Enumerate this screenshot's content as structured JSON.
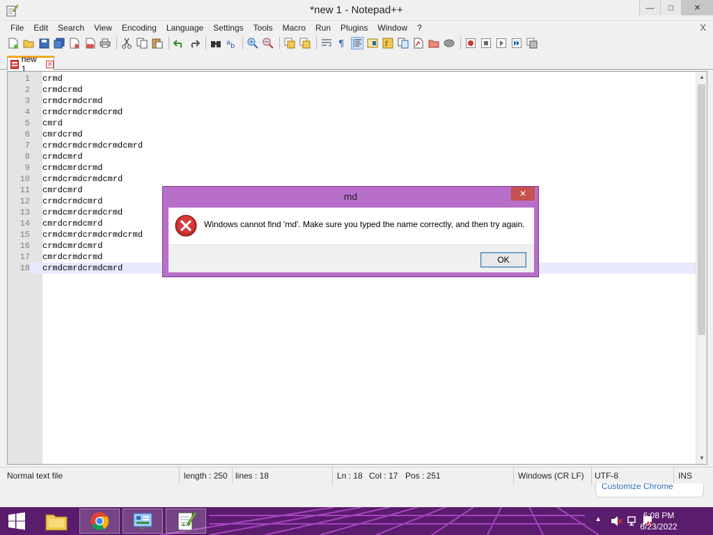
{
  "window": {
    "title": "*new 1 - Notepad++",
    "minimize_glyph": "—",
    "maximize_glyph": "□",
    "close_glyph": "✕"
  },
  "menu": {
    "items": [
      "File",
      "Edit",
      "Search",
      "View",
      "Encoding",
      "Language",
      "Settings",
      "Tools",
      "Macro",
      "Run",
      "Plugins",
      "Window",
      "?"
    ],
    "close_glyph": "X"
  },
  "toolbar": {
    "icons": [
      "new-file-icon",
      "open-file-icon",
      "save-icon",
      "save-all-icon",
      "close-icon",
      "close-all-icon",
      "print-icon",
      "sep",
      "cut-icon",
      "copy-icon",
      "paste-icon",
      "sep",
      "undo-icon",
      "redo-icon",
      "sep",
      "find-icon",
      "replace-icon",
      "sep",
      "zoom-in-icon",
      "zoom-out-icon",
      "sep",
      "sync-vertical-icon",
      "sync-horizontal-icon",
      "sep",
      "word-wrap-icon",
      "show-all-chars-icon",
      "indent-guide-icon",
      "document-map-icon",
      "function-list-icon",
      "folder-as-workspace-icon",
      "monitoring-icon",
      "sep",
      "record-macro-icon",
      "stop-macro-icon",
      "play-macro-icon",
      "run-macro-multiple-icon",
      "save-macro-icon"
    ]
  },
  "tab": {
    "label": "new 1",
    "close_glyph": "✕"
  },
  "editor": {
    "lines": [
      {
        "n": "1",
        "text": "crmd"
      },
      {
        "n": "2",
        "text": "crmdcrmd"
      },
      {
        "n": "3",
        "text": "crmdcrmdcrmd"
      },
      {
        "n": "4",
        "text": "crmdcrmdcrmdcrmd"
      },
      {
        "n": "5",
        "text": "cmrd"
      },
      {
        "n": "6",
        "text": "cmrdcrmd"
      },
      {
        "n": "7",
        "text": "crmdcrmdcrmdcrmdcmrd"
      },
      {
        "n": "8",
        "text": "crmdcmrd"
      },
      {
        "n": "9",
        "text": "crmdcmrdcrmd"
      },
      {
        "n": "10",
        "text": "crmdcrmdcrmdcmrd"
      },
      {
        "n": "11",
        "text": "cmrdcmrd"
      },
      {
        "n": "12",
        "text": "crmdcrmdcmrd"
      },
      {
        "n": "13",
        "text": "crmdcmrdcrmdcrmd"
      },
      {
        "n": "14",
        "text": "cmrdcrmdcmrd"
      },
      {
        "n": "15",
        "text": "crmdcmrdcrmdcrmdcrmd"
      },
      {
        "n": "16",
        "text": "crmdcmrdcmrd"
      },
      {
        "n": "17",
        "text": "cmrdcrmdcrmd"
      },
      {
        "n": "18",
        "text": "crmdcmrdcrmdcmrd"
      }
    ],
    "current_line": 18
  },
  "status": {
    "file_type": "Normal text file",
    "length": "length : 250",
    "lines": "lines : 18",
    "ln": "Ln : 18",
    "col": "Col : 17",
    "pos": "Pos : 251",
    "eol": "Windows (CR LF)",
    "encoding": "UTF-8",
    "mode": "INS"
  },
  "notification": {
    "text": "Customize Chrome"
  },
  "dialog": {
    "title": "md",
    "message": "Windows cannot find 'md'. Make sure you typed the name correctly, and then try again.",
    "ok_label": "OK",
    "close_glyph": "✕"
  },
  "taskbar": {
    "apps": [
      "file-explorer-icon",
      "chrome-icon",
      "control-panel-icon",
      "notepad-plus-plus-icon"
    ],
    "time": "6:08 PM",
    "date": "6/23/2022",
    "colors": {
      "base": "#5a1c6c",
      "stripe": "#b44cd0"
    }
  }
}
